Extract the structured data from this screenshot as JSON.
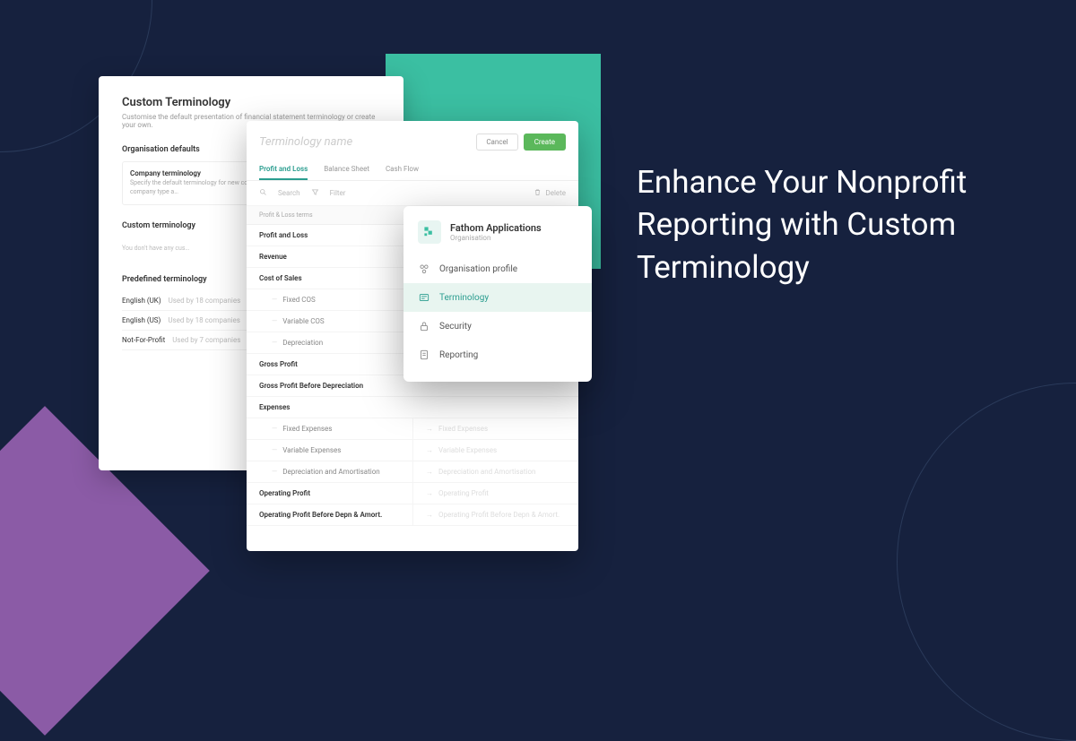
{
  "headline": "Enhance Your Nonprofit Reporting with Custom Terminology",
  "cardBack": {
    "title": "Custom Terminology",
    "subtitle": "Customise the default presentation of financial statement terminology or create your own.",
    "orgDefaults": {
      "heading": "Organisation defaults",
      "boxTitle": "Company terminology",
      "boxDesc": "Specify the default terminology for new companies, predefined terminology based on company type a…"
    },
    "customTerm": {
      "heading": "Custom terminology",
      "empty": "You don't have any cus…"
    },
    "predefined": {
      "heading": "Predefined terminology",
      "rows": [
        {
          "name": "English (UK)",
          "meta": "Used by 18 companies"
        },
        {
          "name": "English (US)",
          "meta": "Used by 18 companies"
        },
        {
          "name": "Not-For-Profit",
          "meta": "Used by 7 companies"
        }
      ]
    }
  },
  "cardFront": {
    "placeholder": "Terminology name",
    "cancel": "Cancel",
    "create": "Create",
    "tabs": [
      "Profit and Loss",
      "Balance Sheet",
      "Cash Flow"
    ],
    "search": "Search",
    "filter": "Filter",
    "delete": "Delete",
    "sectionHeader": "Profit & Loss terms",
    "terms": [
      {
        "label": "Profit and Loss",
        "bold": true
      },
      {
        "label": "Revenue",
        "bold": true
      },
      {
        "label": "Cost of Sales",
        "bold": true
      },
      {
        "label": "Fixed COS",
        "sub": true
      },
      {
        "label": "Variable COS",
        "sub": true
      },
      {
        "label": "Depreciation",
        "sub": true
      },
      {
        "label": "Gross Profit",
        "bold": true
      },
      {
        "label": "Gross Profit Before Depreciation",
        "bold": true
      },
      {
        "label": "Expenses",
        "bold": true
      }
    ],
    "splitTerms": [
      {
        "label": "Fixed Expenses",
        "sub": true
      },
      {
        "label": "Variable Expenses",
        "sub": true
      },
      {
        "label": "Depreciation and Amortisation",
        "sub": true
      },
      {
        "label": "Operating Profit",
        "bold": true
      },
      {
        "label": "Operating Profit Before Depn & Amort.",
        "bold": true
      }
    ]
  },
  "popover": {
    "orgName": "Fathom Applications",
    "orgSub": "Organisation",
    "items": [
      {
        "label": "Organisation profile",
        "icon": "profile"
      },
      {
        "label": "Terminology",
        "icon": "terminology",
        "active": true
      },
      {
        "label": "Security",
        "icon": "security"
      },
      {
        "label": "Reporting",
        "icon": "reporting"
      }
    ]
  }
}
